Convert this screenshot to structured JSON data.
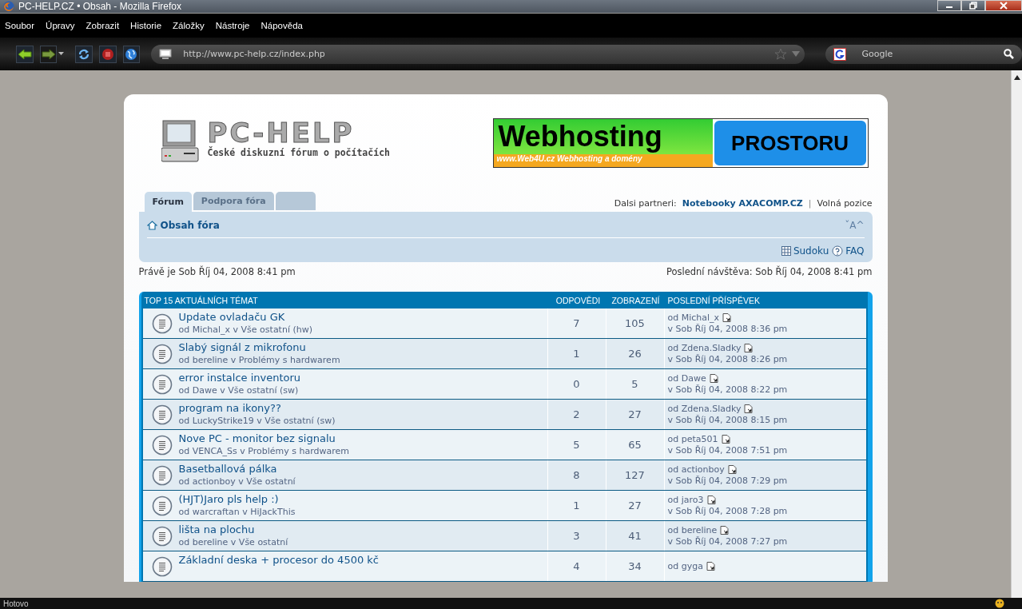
{
  "window": {
    "title": "PC-HELP.CZ • Obsah - Mozilla Firefox"
  },
  "menu": [
    {
      "label": "Soubor"
    },
    {
      "label": "Úpravy"
    },
    {
      "label": "Zobrazit"
    },
    {
      "label": "Historie"
    },
    {
      "label": "Záložky"
    },
    {
      "label": "Nástroje"
    },
    {
      "label": "Nápověda"
    }
  ],
  "toolbar": {
    "url": "http://www.pc-help.cz/index.php",
    "search_placeholder": "Google"
  },
  "site": {
    "logo_title": "PC-HELP",
    "logo_subtitle": "České diskuzní fórum o počítačích",
    "banner_title": "Webhosting",
    "banner_subtitle": "www.Web4U.cz  Webhosting a domény",
    "banner_side": "PROSTORU"
  },
  "tabs": [
    {
      "label": "Fórum",
      "selected": true
    },
    {
      "label": "Podpora fóra",
      "selected": false
    },
    {
      "selected": false
    }
  ],
  "partners": {
    "label": "Dalsi partneri:",
    "link": "Notebooky AXACOMP.CZ",
    "separator": "|",
    "other": "Volná pozice"
  },
  "breadcrumb": "Obsah fóra",
  "font_size_control": "ˇA^",
  "nav_links": [
    {
      "label": "Sudoku",
      "kind": "grid"
    },
    {
      "label": "FAQ",
      "kind": "help"
    }
  ],
  "current_time": "Právě je Sob Říj 04, 2008 8:41 pm",
  "last_visit": "Poslední návštěva: Sob Říj 04, 2008 8:41 pm",
  "table": {
    "columns": [
      "TOP 15 AKTUÁLNÍCH TÉMAT",
      "ODPOVĚDI",
      "ZOBRAZENÍ",
      "POSLEDNÍ PŘÍSPĚVEK"
    ],
    "rows": [
      {
        "title": "Update ovladaču GK",
        "subtitle": "od Michal_x v Vše ostatní (hw)",
        "replies": "7",
        "views": "105",
        "last_by": "od Michal_x",
        "last_at": "v Sob Říj 04, 2008 8:36 pm"
      },
      {
        "title": "Slabý signál z mikrofonu",
        "subtitle": "od bereline v Problémy s hardwarem",
        "replies": "1",
        "views": "26",
        "last_by": "od Zdena.Sladky",
        "last_at": "v Sob Říj 04, 2008 8:26 pm"
      },
      {
        "title": "error instalce inventoru",
        "subtitle": "od Dawe v Vše ostatní (sw)",
        "replies": "0",
        "views": "5",
        "last_by": "od Dawe",
        "last_at": "v Sob Říj 04, 2008 8:22 pm"
      },
      {
        "title": "program na ikony??",
        "subtitle": "od LuckyStrike19 v Vše ostatní (sw)",
        "replies": "2",
        "views": "27",
        "last_by": "od Zdena.Sladky",
        "last_at": "v Sob Říj 04, 2008 8:15 pm"
      },
      {
        "title": "Nove PC - monitor bez signalu",
        "subtitle": "od VENCA_Ss v Problémy s hardwarem",
        "replies": "5",
        "views": "65",
        "last_by": "od peta501",
        "last_at": "v Sob Říj 04, 2008 7:51 pm"
      },
      {
        "title": "Basetballová pálka",
        "subtitle": "od actionboy v Vše ostatní",
        "replies": "8",
        "views": "127",
        "last_by": "od actionboy",
        "last_at": "v Sob Říj 04, 2008 7:29 pm"
      },
      {
        "title": "(HJT)Jaro pls help :)",
        "subtitle": "od warcraftan v HiJackThis",
        "replies": "1",
        "views": "27",
        "last_by": "od jaro3",
        "last_at": "v Sob Říj 04, 2008 7:28 pm"
      },
      {
        "title": "lišta na plochu",
        "subtitle": "od bereline v Vše ostatní",
        "replies": "3",
        "views": "41",
        "last_by": "od bereline",
        "last_at": "v Sob Říj 04, 2008 7:27 pm"
      },
      {
        "title": "Základní deska + procesor do 4500 kč",
        "replies": "4",
        "views": "34",
        "last_by": "od gyga"
      }
    ]
  },
  "status_bar": {
    "text": "Hotovo"
  }
}
